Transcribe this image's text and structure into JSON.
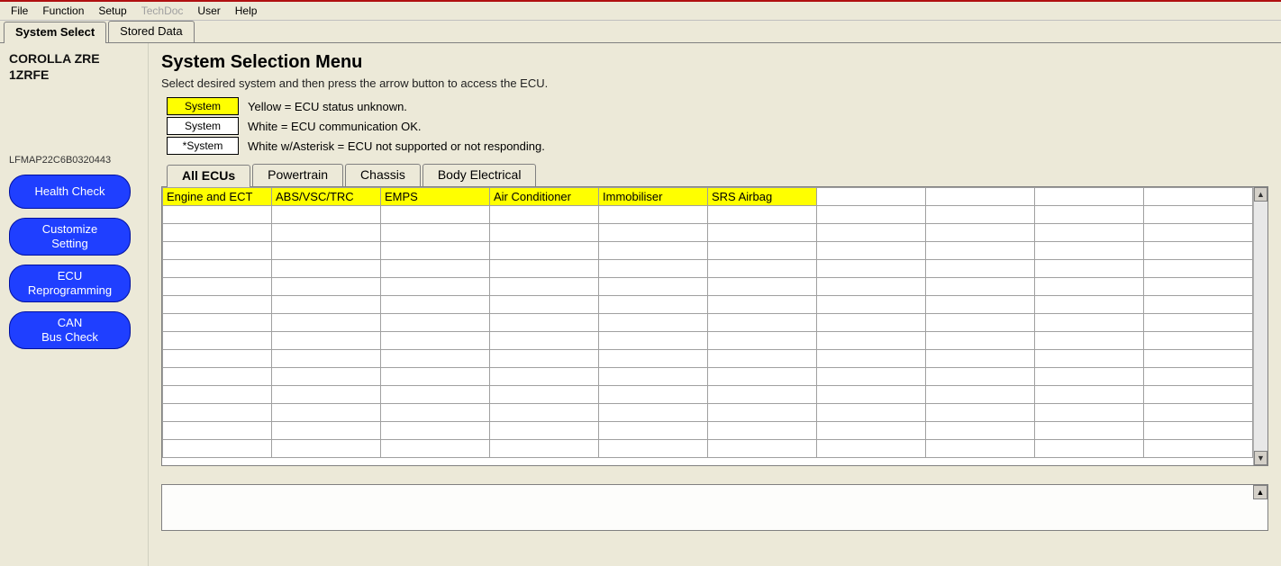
{
  "menubar": {
    "items": [
      {
        "label": "File",
        "enabled": true
      },
      {
        "label": "Function",
        "enabled": true
      },
      {
        "label": "Setup",
        "enabled": true
      },
      {
        "label": "TechDoc",
        "enabled": false
      },
      {
        "label": "User",
        "enabled": true
      },
      {
        "label": "Help",
        "enabled": true
      }
    ]
  },
  "top_tabs": {
    "items": [
      {
        "label": "System Select",
        "active": true
      },
      {
        "label": "Stored Data",
        "active": false
      }
    ]
  },
  "sidebar": {
    "vehicle_line1": "COROLLA ZRE",
    "vehicle_line2": "1ZRFE",
    "vin": "LFMAP22C6B0320443",
    "buttons": [
      {
        "id": "health-check",
        "label": "Health Check"
      },
      {
        "id": "customize-setting",
        "label": "Customize\nSetting"
      },
      {
        "id": "ecu-reprogramming",
        "label": "ECU\nReprogramming"
      },
      {
        "id": "can-bus-check",
        "label": "CAN\nBus Check"
      }
    ]
  },
  "main": {
    "title": "System Selection Menu",
    "subtitle": "Select desired system and then press the arrow button to access the ECU.",
    "legend": [
      {
        "swatch_label": "System",
        "swatch_class": "yellow",
        "text": "Yellow = ECU status unknown."
      },
      {
        "swatch_label": "System",
        "swatch_class": "white",
        "text": "White = ECU communication OK."
      },
      {
        "swatch_label": "*System",
        "swatch_class": "white",
        "text": "White w/Asterisk = ECU not supported or not responding."
      }
    ],
    "ecu_tabs": [
      {
        "label": "All ECUs",
        "active": true
      },
      {
        "label": "Powertrain",
        "active": false
      },
      {
        "label": "Chassis",
        "active": false
      },
      {
        "label": "Body Electrical",
        "active": false
      }
    ],
    "grid": {
      "columns": 10,
      "rows": 15,
      "cells_row0": [
        "Engine and ECT",
        "ABS/VSC/TRC",
        "EMPS",
        "Air Conditioner",
        "Immobiliser",
        "SRS Airbag",
        "",
        "",
        "",
        ""
      ]
    }
  },
  "icons": {
    "up": "▲",
    "down": "▼"
  }
}
